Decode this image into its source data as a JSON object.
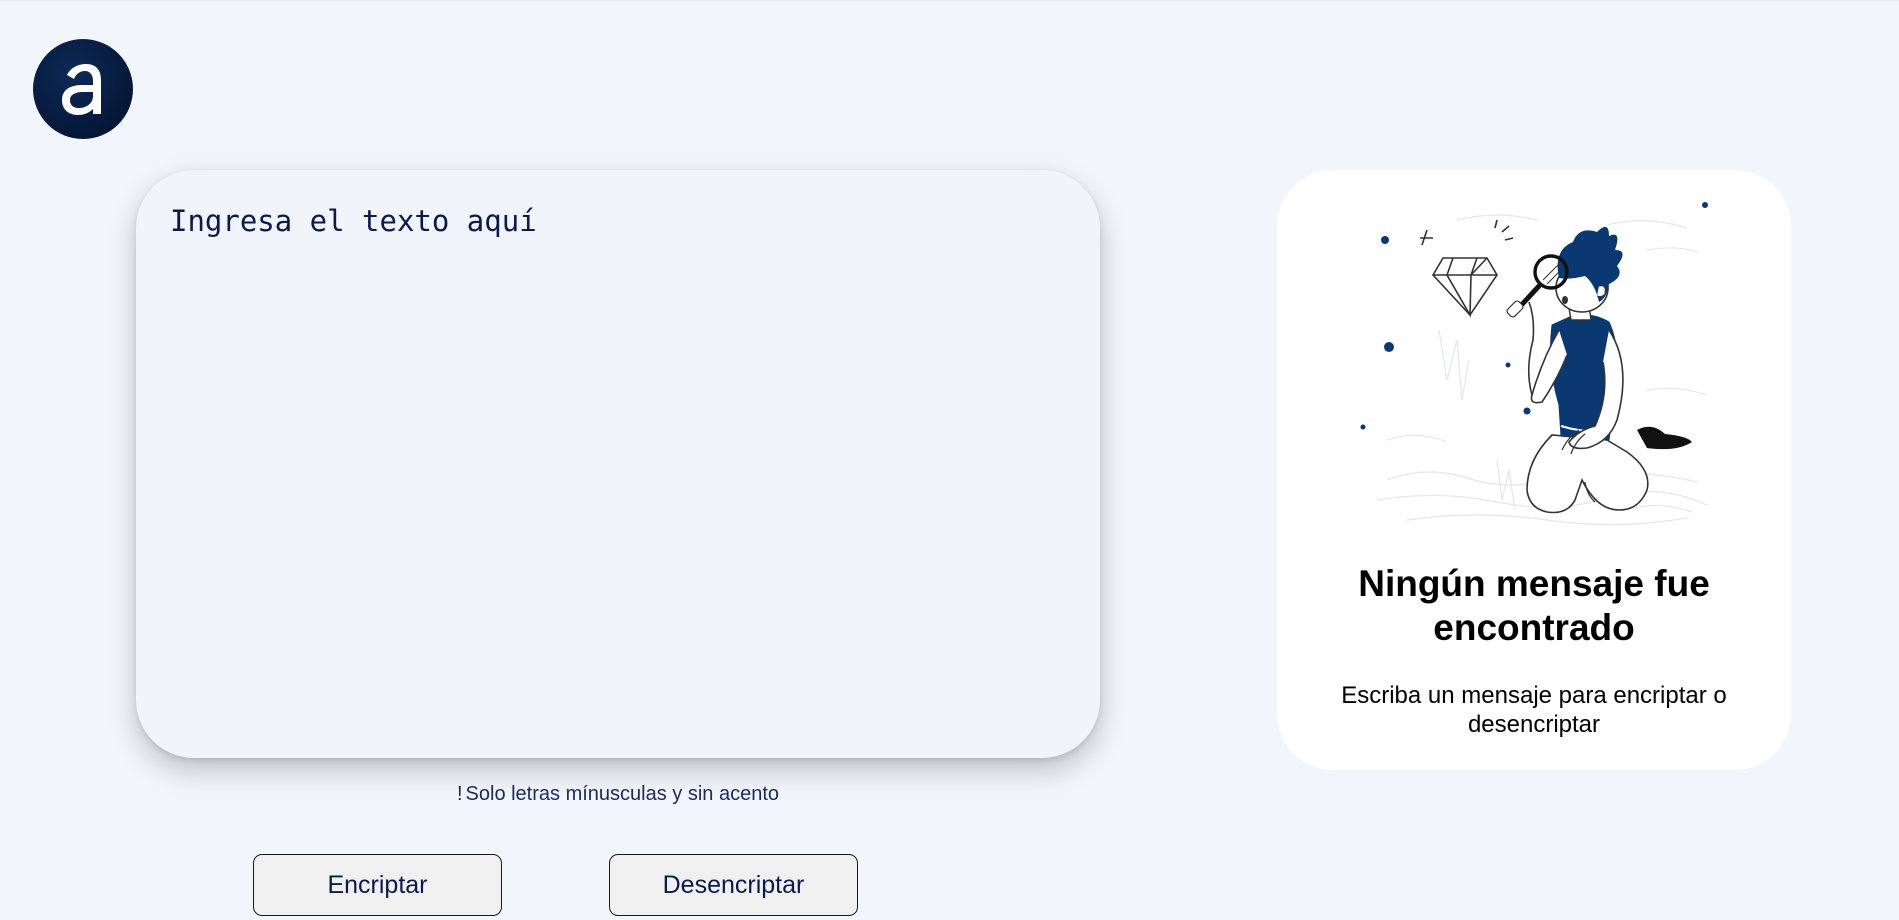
{
  "logo": {
    "icon": "alura-logo-icon",
    "letter": "a"
  },
  "input": {
    "placeholder": "Ingresa el texto aquí",
    "value": ""
  },
  "hint": {
    "icon": "exclamation",
    "mark": "!",
    "text": "Solo letras mínusculas y sin acento"
  },
  "buttons": {
    "encrypt_label": "Encriptar",
    "decrypt_label": "Desencriptar"
  },
  "output": {
    "illustration": "person-with-magnifying-glass-illustration",
    "title": "Ningún mensaje fue encontrado",
    "text": "Escriba un mensaje para encriptar o desencriptar"
  },
  "colors": {
    "background": "#f2f5fc",
    "primary_dark": "#0a3871",
    "text_dark": "#0a1a4a"
  }
}
